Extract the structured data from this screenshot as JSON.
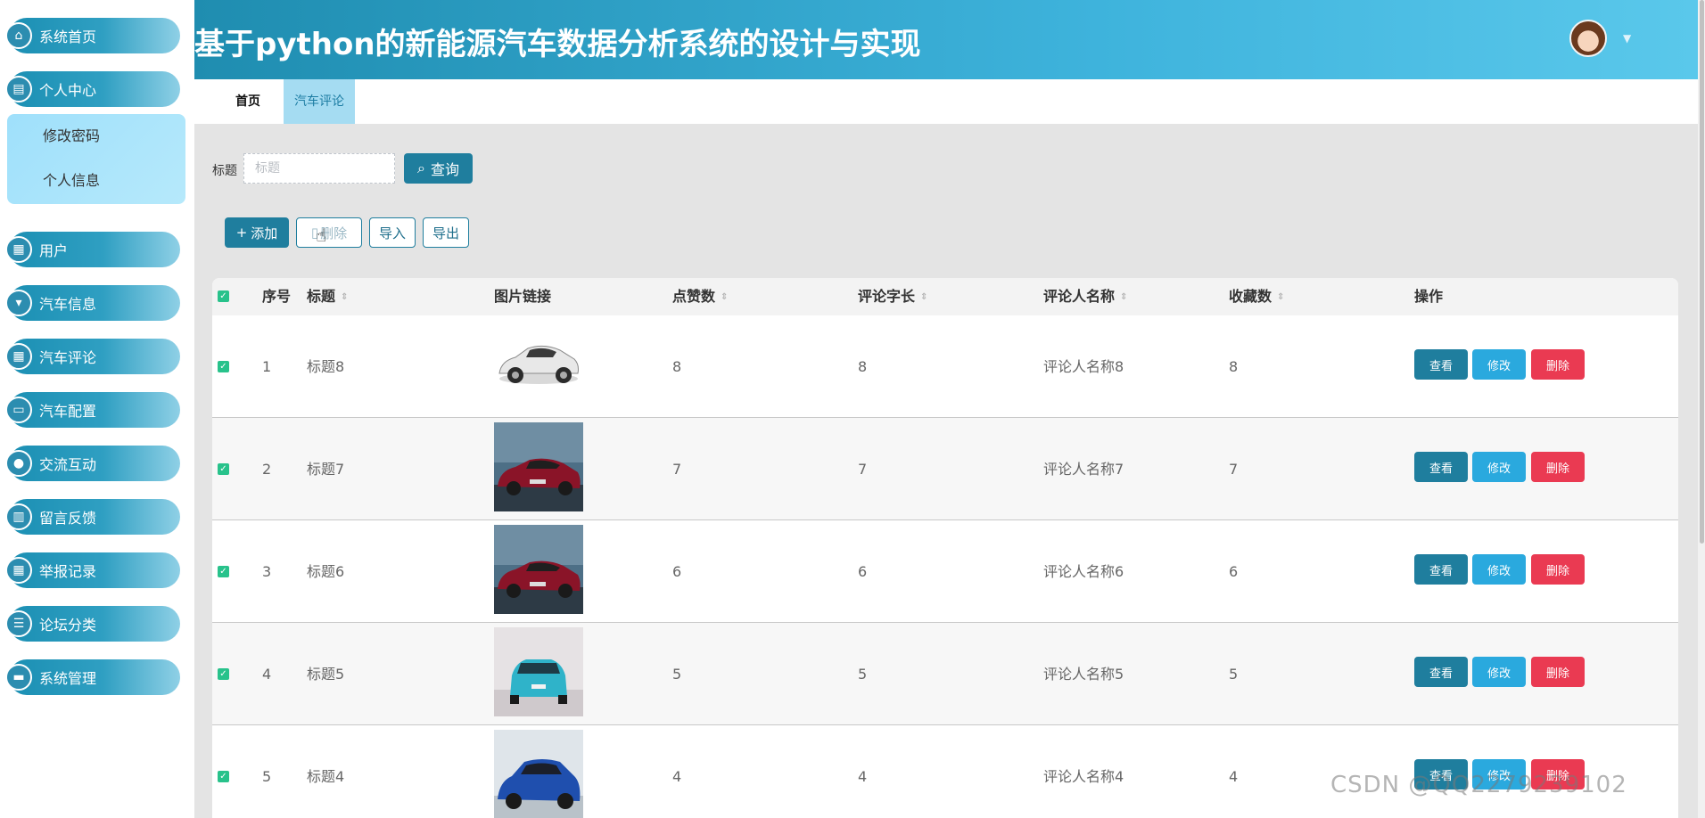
{
  "app": {
    "title": "基于python的新能源汽车数据分析系统的设计与实现"
  },
  "sidebar": {
    "home": "系统首页",
    "personal": "个人中心",
    "sub_items": [
      "修改密码",
      "个人信息"
    ],
    "items": [
      "用户",
      "汽车信息",
      "汽车评论",
      "汽车配置",
      "交流互动",
      "留言反馈",
      "举报记录",
      "论坛分类",
      "系统管理"
    ]
  },
  "tabs": {
    "home": "首页",
    "active": "汽车评论"
  },
  "search": {
    "label": "标题",
    "placeholder": "标题",
    "button": "查询"
  },
  "toolbar": {
    "add": "添加",
    "delete": "删除",
    "import": "导入",
    "export": "导出"
  },
  "table": {
    "headers": [
      "序号",
      "标题",
      "图片链接",
      "点赞数",
      "评论字长",
      "评论人名称",
      "收藏数",
      "操作"
    ],
    "rows": [
      {
        "index": "1",
        "title": "标题8",
        "likes": "8",
        "length": "8",
        "commenter": "评论人名称8",
        "favorites": "8"
      },
      {
        "index": "2",
        "title": "标题7",
        "likes": "7",
        "length": "7",
        "commenter": "评论人名称7",
        "favorites": "7"
      },
      {
        "index": "3",
        "title": "标题6",
        "likes": "6",
        "length": "6",
        "commenter": "评论人名称6",
        "favorites": "6"
      },
      {
        "index": "4",
        "title": "标题5",
        "likes": "5",
        "length": "5",
        "commenter": "评论人名称5",
        "favorites": "5"
      },
      {
        "index": "5",
        "title": "标题4",
        "likes": "4",
        "length": "4",
        "commenter": "评论人名称4",
        "favorites": "4"
      }
    ],
    "actions": {
      "view": "查看",
      "edit": "修改",
      "delete": "删除"
    }
  },
  "watermark": "CSDN @QQ2279239102",
  "colors": {
    "primary": "#1f7e9e",
    "header": "#3eb3dc",
    "edit": "#2aa9de",
    "danger": "#ea3a52",
    "check": "#28c28b"
  }
}
